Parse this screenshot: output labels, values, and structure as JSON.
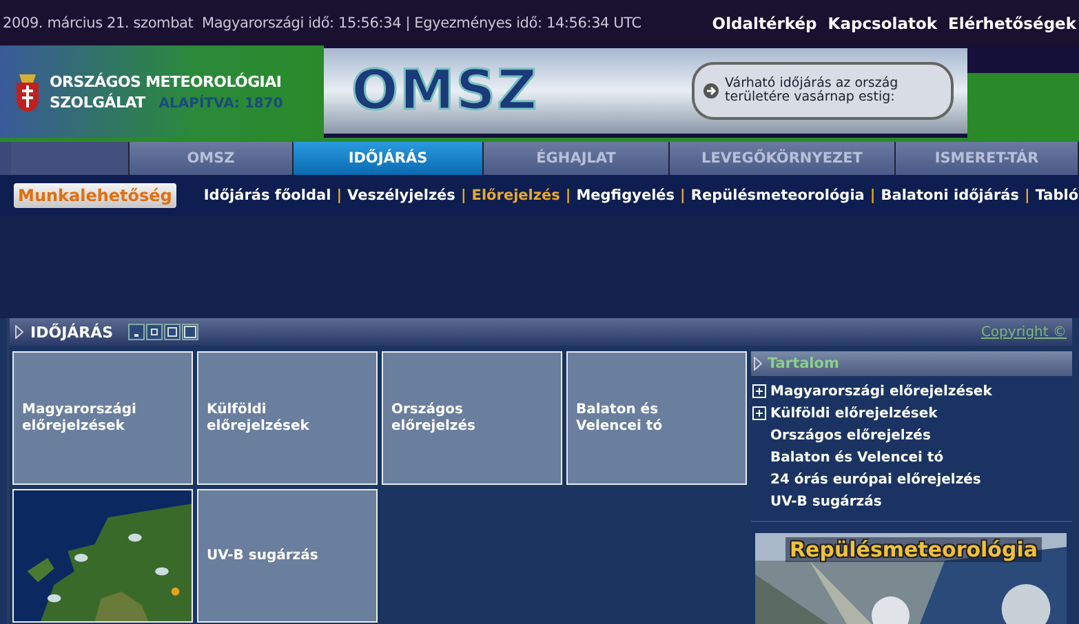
{
  "top_bar": {
    "date_time": "2009. március 21. szombat  Magyarországi idő: 15:56:34 | Egyezményes idő: 14:56:34 UTC",
    "links": [
      "Oldaltérkép",
      "Kapcsolatok",
      "Elérhetőségek"
    ]
  },
  "logo": {
    "line1": "ORSZÁGOS METEOROLÓGIAI",
    "line2": "SZOLGÁLAT",
    "founded": "ALAPÍTVA: 1870"
  },
  "banner": {
    "title": "OMSZ",
    "message": "Várható időjárás az ország területére vasárnap estig:"
  },
  "tabs": [
    {
      "label": "OMSZ",
      "selected": false
    },
    {
      "label": "IDŐJÁRÁS",
      "selected": true
    },
    {
      "label": "ÉGHAJLAT",
      "selected": false
    },
    {
      "label": "LEVEGŐKÖRNYEZET",
      "selected": false
    },
    {
      "label": "ISMERET-TÁR",
      "selected": false
    }
  ],
  "subnav": {
    "badge": "Munkalehetőség",
    "separator": "|",
    "links": [
      {
        "label": "Időjárás főoldal",
        "selected": false
      },
      {
        "label": "Veszélyjelzés",
        "selected": false
      },
      {
        "label": "Előrejelzés",
        "selected": true
      },
      {
        "label": "Megfigyelés",
        "selected": false
      },
      {
        "label": "Repülésmeteorológia",
        "selected": false
      },
      {
        "label": "Balatoni időjárás",
        "selected": false
      },
      {
        "label": "Tabló",
        "selected": false
      }
    ]
  },
  "panel": {
    "title": "IDŐJÁRÁS",
    "copyright": "Copyright ©",
    "tiles": [
      {
        "kind": "text",
        "label": "Magyarországi előrejelzések"
      },
      {
        "kind": "text",
        "label": "Külföldi előrejelzések"
      },
      {
        "kind": "text",
        "label": "Országos előrejelzés"
      },
      {
        "kind": "text",
        "label": "Balaton és Velencei tó"
      },
      {
        "kind": "picture"
      },
      {
        "kind": "text",
        "label": "UV-B sugárzás"
      }
    ]
  },
  "sidebar": {
    "title": "Tartalom",
    "items": [
      {
        "label": "Magyarországi előrejelzések",
        "expandable": true
      },
      {
        "label": "Külföldi előrejelzések",
        "expandable": true
      },
      {
        "label": "Országos előrejelzés",
        "expandable": false
      },
      {
        "label": "Balaton és Velencei tó",
        "expandable": false
      },
      {
        "label": "24 órás európai előrejelzés",
        "expandable": false
      },
      {
        "label": "UV-B sugárzás",
        "expandable": false
      }
    ],
    "promo": "Repülésmeteorológia"
  }
}
